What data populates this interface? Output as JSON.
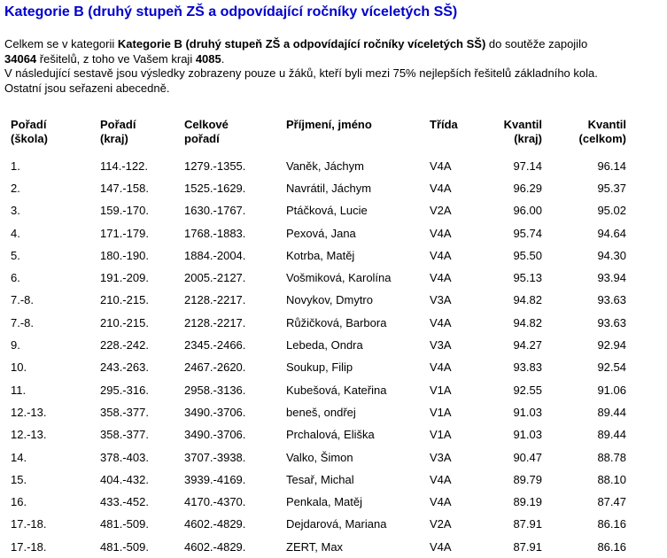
{
  "title": "Kategorie B (druhý stupeň ZŠ a odpovídající ročníky víceletých SŠ)",
  "intro": {
    "l1_a": "Celkem se v kategorii ",
    "l1_b": "Kategorie B (druhý stupeň ZŠ a odpovídající ročníky víceletých SŠ)",
    "l1_c": " do soutěže zapojilo",
    "l2_a": "34064",
    "l2_b": " řešitelů, z toho ve Vašem kraji ",
    "l2_c": "4085",
    "l2_d": ".",
    "l3": "V následující sestavě jsou výsledky zobrazeny pouze u žáků, kteří byli mezi 75% nejlepších řešitelů základního kola.",
    "l4": "Ostatní jsou seřazeni abecedně."
  },
  "headers": {
    "rank_school_1": "Pořadí",
    "rank_school_2": "(škola)",
    "rank_region_1": "Pořadí",
    "rank_region_2": "(kraj)",
    "rank_total_1": "Celkové",
    "rank_total_2": "pořadí",
    "name": "Příjmení, jméno",
    "class": "Třída",
    "q_region_1": "Kvantil",
    "q_region_2": "(kraj)",
    "q_total_1": "Kvantil",
    "q_total_2": "(celkom)"
  },
  "rows": [
    {
      "school": "1.",
      "region": "114.-122.",
      "total": "1279.-1355.",
      "name": "Vaněk, Jáchym",
      "cls": "V4A",
      "qr": "97.14",
      "qt": "96.14"
    },
    {
      "school": "2.",
      "region": "147.-158.",
      "total": "1525.-1629.",
      "name": "Navrátil, Jáchym",
      "cls": "V4A",
      "qr": "96.29",
      "qt": "95.37"
    },
    {
      "school": "3.",
      "region": "159.-170.",
      "total": "1630.-1767.",
      "name": "Ptáčková, Lucie",
      "cls": "V2A",
      "qr": "96.00",
      "qt": "95.02"
    },
    {
      "school": "4.",
      "region": "171.-179.",
      "total": "1768.-1883.",
      "name": "Pexová, Jana",
      "cls": "V4A",
      "qr": "95.74",
      "qt": "94.64"
    },
    {
      "school": "5.",
      "region": "180.-190.",
      "total": "1884.-2004.",
      "name": "Kotrba, Matěj",
      "cls": "V4A",
      "qr": "95.50",
      "qt": "94.30"
    },
    {
      "school": "6.",
      "region": "191.-209.",
      "total": "2005.-2127.",
      "name": "Vošmiková, Karolína",
      "cls": "V4A",
      "qr": "95.13",
      "qt": "93.94"
    },
    {
      "school": "7.-8.",
      "region": "210.-215.",
      "total": "2128.-2217.",
      "name": "Novykov, Dmytro",
      "cls": "V3A",
      "qr": "94.82",
      "qt": "93.63"
    },
    {
      "school": "7.-8.",
      "region": "210.-215.",
      "total": "2128.-2217.",
      "name": "Růžičková, Barbora",
      "cls": "V4A",
      "qr": "94.82",
      "qt": "93.63"
    },
    {
      "school": "9.",
      "region": "228.-242.",
      "total": "2345.-2466.",
      "name": "Lebeda, Ondra",
      "cls": "V3A",
      "qr": "94.27",
      "qt": "92.94"
    },
    {
      "school": "10.",
      "region": "243.-263.",
      "total": "2467.-2620.",
      "name": "Soukup, Filip",
      "cls": "V4A",
      "qr": "93.83",
      "qt": "92.54"
    },
    {
      "school": "11.",
      "region": "295.-316.",
      "total": "2958.-3136.",
      "name": "Kubešová, Kateřina",
      "cls": "V1A",
      "qr": "92.55",
      "qt": "91.06"
    },
    {
      "school": "12.-13.",
      "region": "358.-377.",
      "total": "3490.-3706.",
      "name": "beneš, ondřej",
      "cls": "V1A",
      "qr": "91.03",
      "qt": "89.44"
    },
    {
      "school": "12.-13.",
      "region": "358.-377.",
      "total": "3490.-3706.",
      "name": "Prchalová, Eliška",
      "cls": "V1A",
      "qr": "91.03",
      "qt": "89.44"
    },
    {
      "school": "14.",
      "region": "378.-403.",
      "total": "3707.-3938.",
      "name": "Valko, Šimon",
      "cls": "V3A",
      "qr": "90.47",
      "qt": "88.78"
    },
    {
      "school": "15.",
      "region": "404.-432.",
      "total": "3939.-4169.",
      "name": "Tesař, Michal",
      "cls": "V4A",
      "qr": "89.79",
      "qt": "88.10"
    },
    {
      "school": "16.",
      "region": "433.-452.",
      "total": "4170.-4370.",
      "name": "Penkala, Matěj",
      "cls": "V4A",
      "qr": "89.19",
      "qt": "87.47"
    },
    {
      "school": "17.-18.",
      "region": "481.-509.",
      "total": "4602.-4829.",
      "name": "Dejdarová, Mariana",
      "cls": "V2A",
      "qr": "87.91",
      "qt": "86.16"
    },
    {
      "school": "17.-18.",
      "region": "481.-509.",
      "total": "4602.-4829.",
      "name": "ZERT, Max",
      "cls": "V4A",
      "qr": "87.91",
      "qt": "86.16"
    }
  ]
}
